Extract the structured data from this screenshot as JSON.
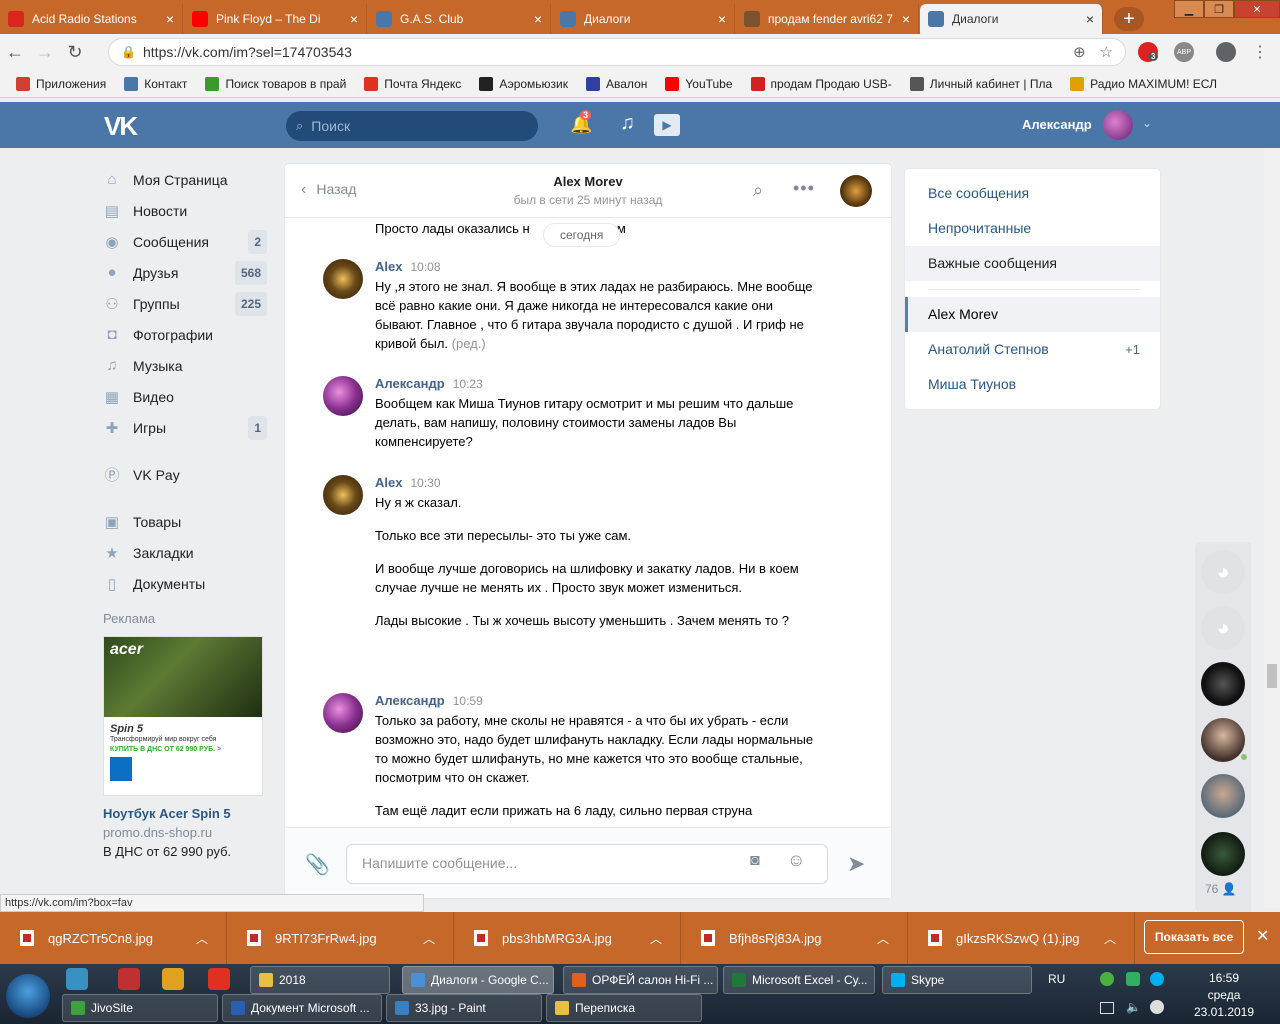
{
  "browser": {
    "tabs": [
      {
        "title": "Acid Radio Stations",
        "color": "#d9261c",
        "icon": "radio-icon"
      },
      {
        "title": "Pink Floyd – The Di",
        "color": "#ff0000",
        "icon": "youtube-icon"
      },
      {
        "title": "G.A.S. Club",
        "color": "#4a76a8",
        "icon": "vk-icon"
      },
      {
        "title": "Диалоги",
        "color": "#4a76a8",
        "icon": "chat-icon"
      },
      {
        "title": "продам fender avri62 7",
        "color": "#7a5230",
        "icon": "guitar-icon"
      },
      {
        "title": "Диалоги",
        "color": "#4a76a8",
        "icon": "chat-icon"
      }
    ],
    "url": "https://vk.com/im?sel=174703543",
    "bookmarks": [
      {
        "label": "Приложения",
        "color": "#d04030"
      },
      {
        "label": "Контакт",
        "color": "#4a76a8"
      },
      {
        "label": "Поиск товаров в прай",
        "color": "#3a9a2a"
      },
      {
        "label": "Почта Яндекс",
        "color": "#e03020"
      },
      {
        "label": "Аэромьюзик",
        "color": "#222222"
      },
      {
        "label": "Авалон",
        "color": "#3040a0"
      },
      {
        "label": "YouTube",
        "color": "#ff0000"
      },
      {
        "label": "продам Продаю USB-",
        "color": "#d02020"
      },
      {
        "label": "Личный кабинет | Пла",
        "color": "#555555"
      },
      {
        "label": "Радио MAXIMUM! ЕСЛ",
        "color": "#e0a000"
      }
    ],
    "ext_badge": "3",
    "ext_abr": "АВР",
    "status_url": "https://vk.com/im?box=fav"
  },
  "vk": {
    "search_placeholder": "Поиск",
    "notif_count": "3",
    "user_name": "Александр",
    "menu": [
      {
        "label": "Моя Страница",
        "icon": "home-icon",
        "count": ""
      },
      {
        "label": "Новости",
        "icon": "news-icon",
        "count": ""
      },
      {
        "label": "Сообщения",
        "icon": "messages-icon",
        "count": "2"
      },
      {
        "label": "Друзья",
        "icon": "friends-icon",
        "count": "568"
      },
      {
        "label": "Группы",
        "icon": "groups-icon",
        "count": "225"
      },
      {
        "label": "Фотографии",
        "icon": "camera-icon",
        "count": ""
      },
      {
        "label": "Музыка",
        "icon": "music-icon",
        "count": ""
      },
      {
        "label": "Видео",
        "icon": "video-icon",
        "count": ""
      },
      {
        "label": "Игры",
        "icon": "games-icon",
        "count": "1"
      }
    ],
    "menu2": [
      {
        "label": "VK Pay",
        "icon": "vkpay-icon"
      }
    ],
    "menu3": [
      {
        "label": "Товары",
        "icon": "bag-icon"
      },
      {
        "label": "Закладки",
        "icon": "star-icon"
      },
      {
        "label": "Документы",
        "icon": "document-icon"
      }
    ],
    "ad": {
      "label": "Реклама",
      "brand": "acer",
      "product": "Spin 5",
      "tagline": "Трансформируй мир вокруг себя",
      "buy": "КУПИТЬ В ДНС ОТ 62 990 РУБ. >",
      "title": "Ноутбук Acer Spin 5",
      "domain": "promo.dns-shop.ru",
      "price": "В ДНС от 62 990 руб."
    }
  },
  "chat": {
    "back_label": "Назад",
    "name": "Alex Morev",
    "status": "был в сети 25 минут назад",
    "date_pill": "сегодня",
    "prev_tail": "Просто лады оказались н",
    "prev_tail_end": "ем",
    "messages": [
      {
        "author": "Alex",
        "time": "10:08",
        "avatar": "alex",
        "paras": [
          "Ну ,я этого не знал. Я вообще в этих ладах не разбираюсь. Мне вообще всё равно какие они. Я даже никогда не интересовался какие они бывают. Главное , что б гитара звучала породисто с душой . И гриф не кривой был."
        ],
        "edited": "(ред.)"
      },
      {
        "author": "Александр",
        "time": "10:23",
        "avatar": "alx",
        "paras": [
          "Вообщем как Миша Тиунов гитару осмотрит и мы решим что дальше делать, вам напишу, половину стоимости замены ладов Вы компенсируете?"
        ],
        "edited": ""
      },
      {
        "author": "Alex",
        "time": "10:30",
        "avatar": "alex",
        "paras": [
          "Ну я ж сказал.",
          "Только все эти пересылы- это ты уже сам.",
          "И вообще лучше договорись на шлифовку и закатку ладов. Ни в коем случае лучше не менять их . Просто звук может измениться.",
          "Лады высокие . Ты ж хочешь высоту уменьшить . Зачем менять то ?"
        ],
        "edited": ""
      },
      {
        "author": "Александр",
        "time": "10:59",
        "avatar": "alx",
        "paras": [
          "Только за работу, мне сколы не нравятся - а что бы их убрать - если возможно это, надо будет шлифануть накладку. Если лады нормальные то можно будет шлифануть, но мне кажется что это вообще стальные, посмотрим что он скажет.",
          "Там ещё ладит если прижать на 6 ладу, сильно первая струна"
        ],
        "edited": ""
      }
    ],
    "input_placeholder": "Напишите сообщение..."
  },
  "folders": [
    {
      "label": "Все сообщения",
      "count": ""
    },
    {
      "label": "Непрочитанные",
      "count": ""
    },
    {
      "label": "Важные сообщения",
      "count": ""
    },
    {
      "label": "Alex Morev",
      "count": ""
    },
    {
      "label": "Анатолий Степнов",
      "count": "+1"
    },
    {
      "label": "Миша Тиунов",
      "count": ""
    }
  ],
  "chatbar_count": "76",
  "downloads": [
    {
      "name": "qgRZCTr5Cn8.jpg"
    },
    {
      "name": "9RTI73FrRw4.jpg"
    },
    {
      "name": "pbs3hbMRG3A.jpg"
    },
    {
      "name": "Bfjh8sRj83A.jpg"
    },
    {
      "name": "gIkzsRKSzwQ (1).jpg"
    }
  ],
  "downloads_show_all": "Показать все",
  "taskbar": {
    "row1": [
      {
        "label": "2018",
        "color": "#e8c040"
      },
      {
        "label": "Диалоги - Google C...",
        "color": "#4a90d9"
      },
      {
        "label": "ОРФЕЙ салон Hi-Fi ...",
        "color": "#e06020"
      },
      {
        "label": "Microsoft Excel - Су...",
        "color": "#1d7a3a"
      },
      {
        "label": "Skype",
        "color": "#00aff0"
      }
    ],
    "row2": [
      {
        "label": "JivoSite",
        "color": "#40a040"
      },
      {
        "label": "Документ Microsoft ...",
        "color": "#2b5fae"
      },
      {
        "label": "33.jpg - Paint",
        "color": "#3a80c0"
      },
      {
        "label": "Переписка",
        "color": "#e8c040"
      }
    ],
    "lang": "RU",
    "time": "16:59",
    "day": "среда",
    "date": "23.01.2019"
  }
}
